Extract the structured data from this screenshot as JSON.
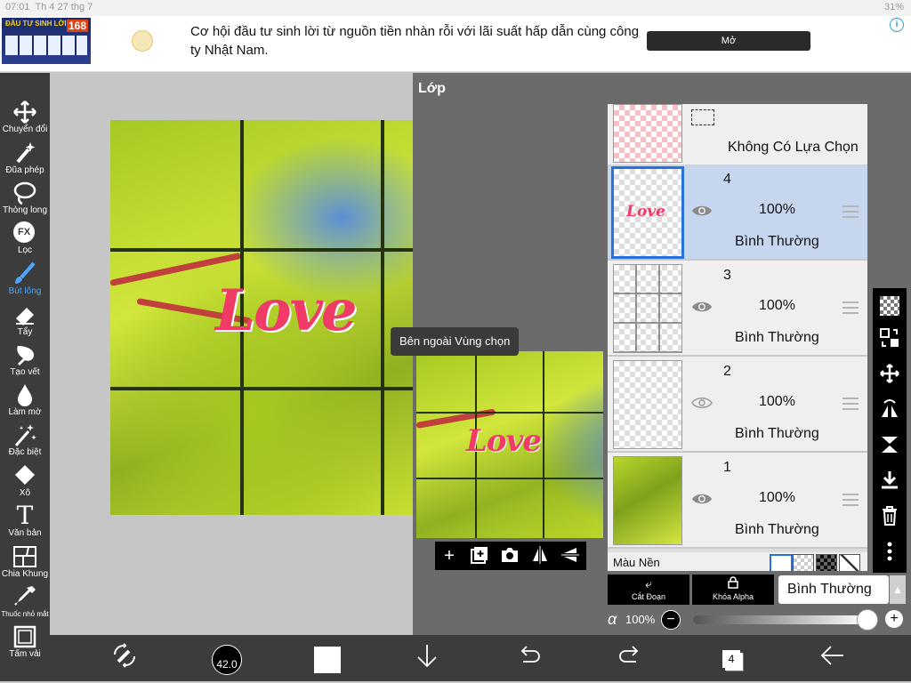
{
  "status_bar": {
    "time": "07:01",
    "date": "Th 4 27 thg 7",
    "battery": "31%"
  },
  "ad": {
    "thumb_title": "ĐẦU TƯ SINH LỜI",
    "thumb_badge": "168",
    "text": "Cơ hội đầu tư sinh lời từ nguồn tiền nhàn rỗi với lãi suất hấp dẫn cùng công ty Nhật Nam.",
    "button": "Mở",
    "info": "i",
    "close": "✕"
  },
  "toolbar": {
    "items": [
      {
        "label": "Chuyển đổi",
        "icon": "move-icon"
      },
      {
        "label": "Đũa phép",
        "icon": "magic-wand-icon"
      },
      {
        "label": "Thòng long",
        "icon": "lasso-icon"
      },
      {
        "label": "Lọc",
        "icon": "fx-filter-icon",
        "glyph": "FX"
      },
      {
        "label": "Bút lông",
        "icon": "brush-icon",
        "active": true
      },
      {
        "label": "Tẩy",
        "icon": "eraser-icon"
      },
      {
        "label": "Tạo vết",
        "icon": "smudge-icon"
      },
      {
        "label": "Làm mờ",
        "icon": "blur-drop-icon"
      },
      {
        "label": "Đặc biệt",
        "icon": "special-wand-icon"
      },
      {
        "label": "Xô",
        "icon": "bucket-icon"
      },
      {
        "label": "Văn bản",
        "icon": "text-icon",
        "glyph": "T"
      },
      {
        "label": "Chia Khung",
        "icon": "frame-divider-icon"
      },
      {
        "label": "Thuốc nhỏ mắt",
        "icon": "eyedropper-icon"
      },
      {
        "label": "Tấm vải",
        "icon": "canvas-icon"
      }
    ]
  },
  "canvas": {
    "art_text": "Love"
  },
  "layers_panel": {
    "title": "Lớp",
    "tooltip": "Bên ngoài Vùng chọn",
    "preview_text": "Love",
    "selection_row": {
      "label": "Không Có Lựa Chọn"
    },
    "layers": [
      {
        "number": "4",
        "opacity": "100%",
        "blend": "Bình Thường",
        "visible": true,
        "selected": true,
        "thumb_text": "Love"
      },
      {
        "number": "3",
        "opacity": "100%",
        "blend": "Bình Thường",
        "visible": true,
        "selected": false
      },
      {
        "number": "2",
        "opacity": "100%",
        "blend": "Bình Thường",
        "visible": false,
        "selected": false
      },
      {
        "number": "1",
        "opacity": "100%",
        "blend": "Bình Thường",
        "visible": true,
        "selected": false
      }
    ],
    "background_label": "Màu Nền",
    "preview_tools": [
      "add-layer-icon",
      "duplicate-layer-icon",
      "camera-icon",
      "flip-horizontal-icon",
      "flip-vertical-icon"
    ],
    "side_tools": [
      "checker-icon",
      "layer-transfer-icon",
      "move-icon",
      "rotate-flip-icon",
      "flip-down-icon",
      "merge-down-icon",
      "trash-icon",
      "more-icon"
    ],
    "clip_button": "Cắt Đoạn",
    "alpha_lock_button": "Khóa Alpha",
    "blend_mode": "Bình Thường",
    "alpha_symbol": "α",
    "alpha_value": "100%",
    "alpha_fraction": 1.0
  },
  "bottom_bar": {
    "brush_size": "42.0",
    "layers_count": "4",
    "color": "#ffffff"
  },
  "colors": {
    "accent": "#4ba6ff",
    "selected_layer": "#c7d6ef",
    "love_pink": "#f03b67",
    "toolbar": "#3c3c3c"
  }
}
